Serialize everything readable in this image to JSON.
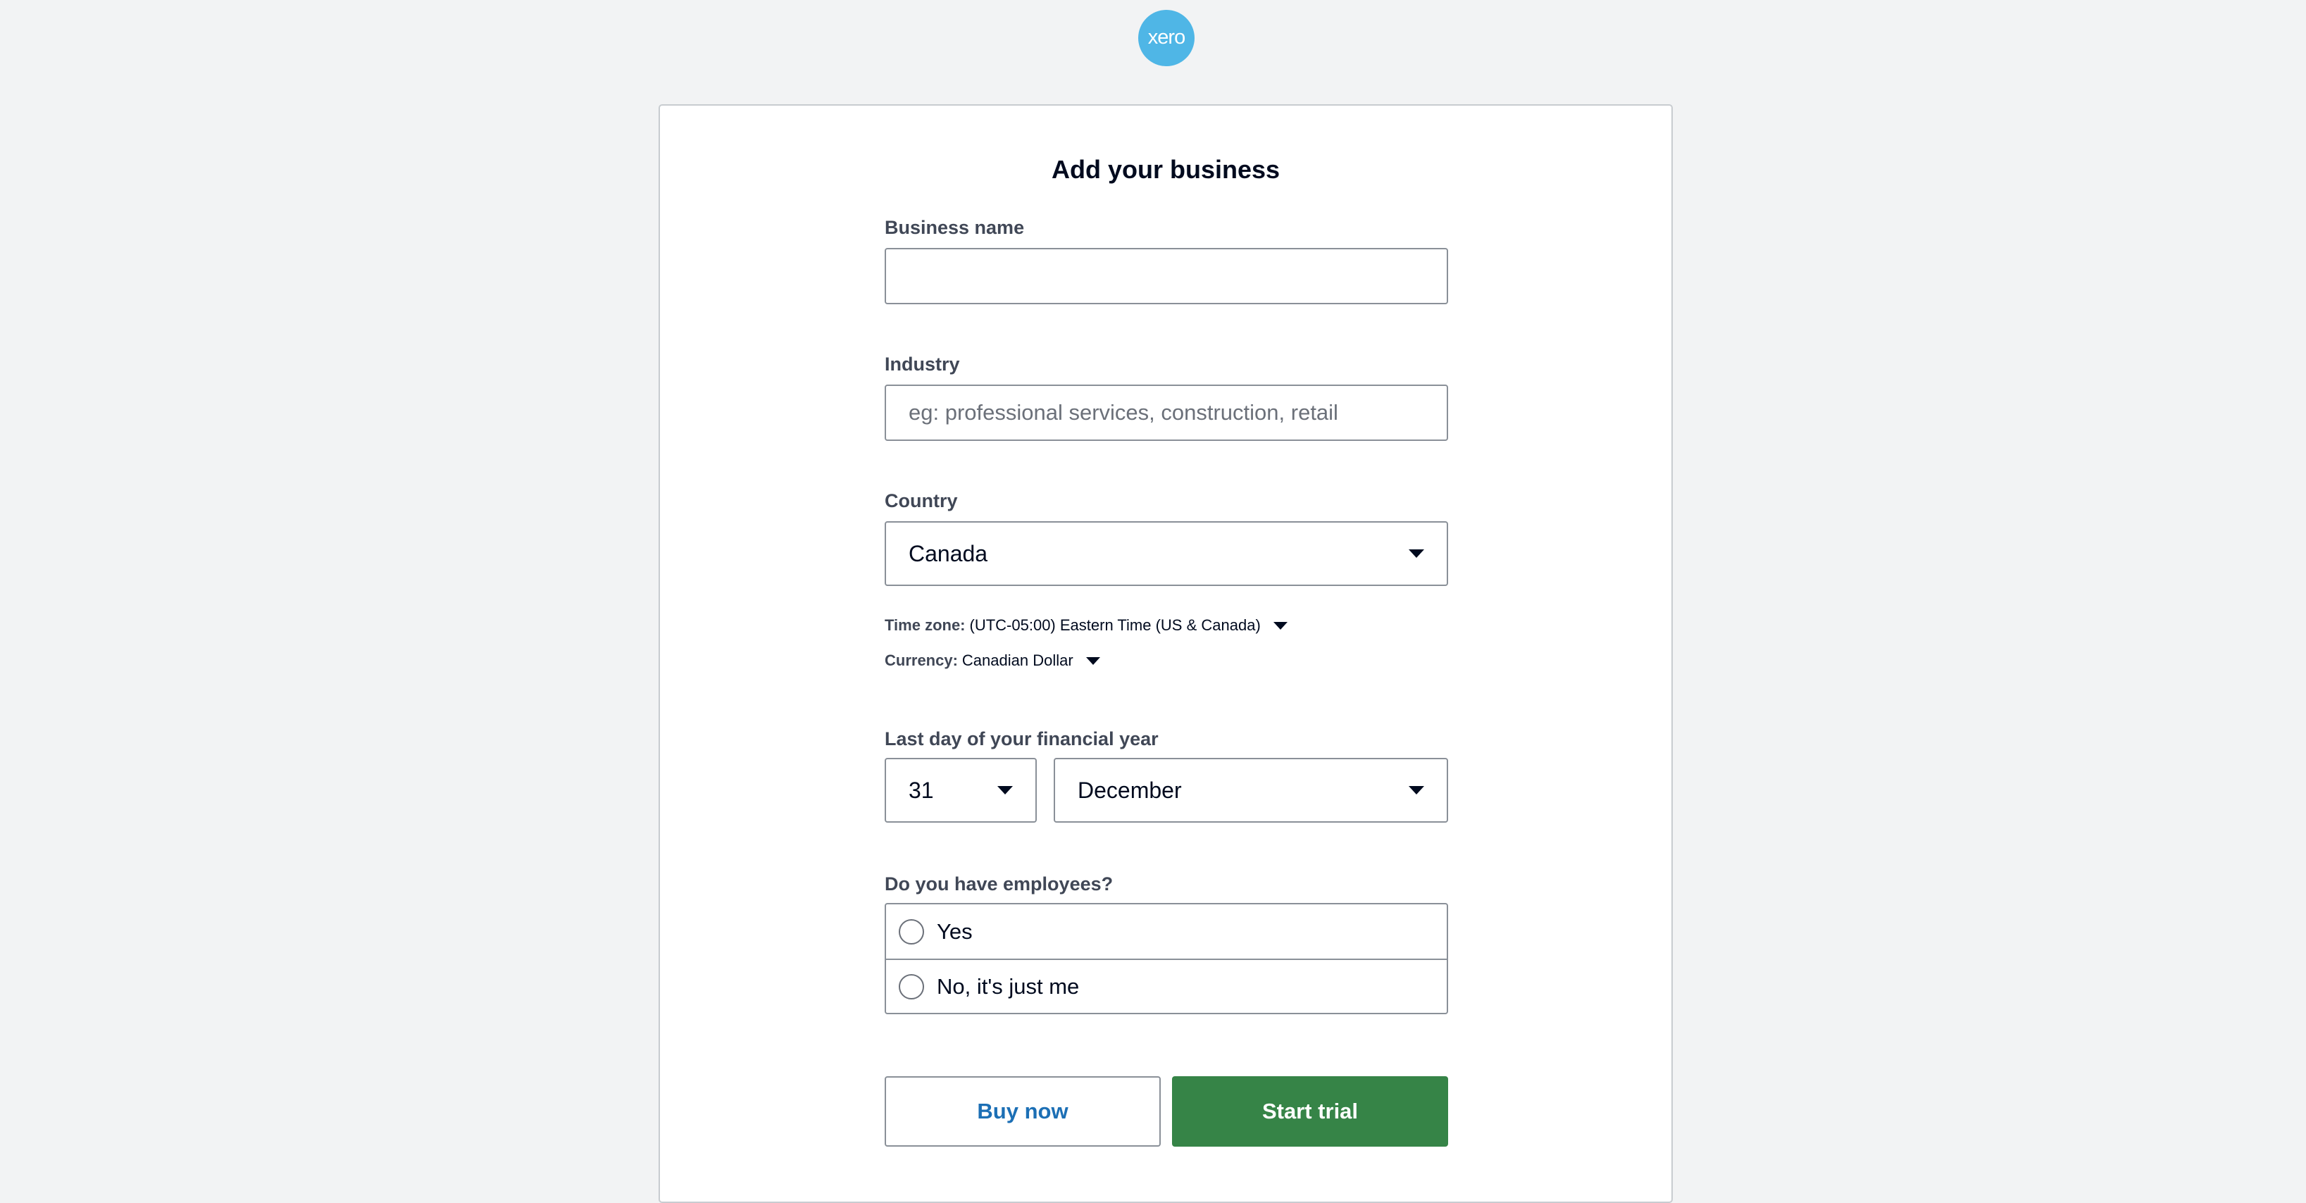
{
  "brand": {
    "logo_text": "xero",
    "logo_color": "#4fb6e6"
  },
  "page": {
    "title": "Add your business"
  },
  "fields": {
    "business_name": {
      "label": "Business name",
      "value": "",
      "placeholder": ""
    },
    "industry": {
      "label": "Industry",
      "value": "",
      "placeholder": "eg: professional services, construction, retail"
    },
    "country": {
      "label": "Country",
      "selected": "Canada",
      "icon": "caret-down-icon"
    },
    "time_zone": {
      "label": "Time zone:",
      "value": "(UTC-05:00) Eastern Time (US & Canada)",
      "icon": "caret-down-icon"
    },
    "currency": {
      "label": "Currency:",
      "value": "Canadian Dollar",
      "icon": "caret-down-icon"
    },
    "financial_year": {
      "label": "Last day of your financial year",
      "day": "31",
      "month": "December"
    },
    "employees": {
      "label": "Do you have employees?",
      "options": [
        "Yes",
        "No, it's just me"
      ],
      "selected": null
    }
  },
  "actions": {
    "buy_now": "Buy now",
    "start_trial": "Start trial"
  },
  "colors": {
    "background": "#f2f3f4",
    "primary_button": "#368447",
    "link_blue": "#1c6fb5",
    "label_grey": "#404756"
  }
}
